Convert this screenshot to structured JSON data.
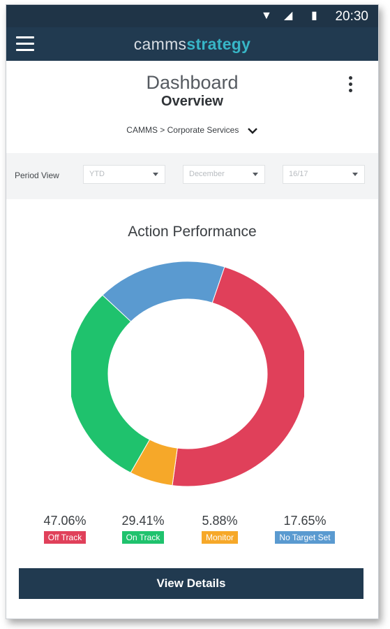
{
  "status_bar": {
    "time": "20:30",
    "icons": [
      "wifi-icon",
      "signal-icon",
      "battery-icon"
    ]
  },
  "app_bar": {
    "brand_part1": "camms",
    "brand_part2": "strategy",
    "menu_icon": "hamburger-icon"
  },
  "header": {
    "title": "Dashboard",
    "subtitle": "Overview",
    "breadcrumb": "CAMMS > Corporate Services",
    "more_icon": "kebab-menu-icon"
  },
  "period": {
    "label": "Period View",
    "selects": [
      {
        "value": "YTD"
      },
      {
        "value": "December"
      },
      {
        "value": "16/17"
      }
    ]
  },
  "chart_data": {
    "type": "pie",
    "title": "Action Performance",
    "donut": true,
    "slices": [
      {
        "label": "Off Track",
        "value": 47.06,
        "display": "47.06%",
        "color": "#e0405a"
      },
      {
        "label": "Monitor",
        "value": 5.88,
        "display": "5.88%",
        "color": "#f6a829"
      },
      {
        "label": "On Track",
        "value": 29.41,
        "display": "29.41%",
        "color": "#1fc26d"
      },
      {
        "label": "No Target Set",
        "value": 17.65,
        "display": "17.65%",
        "color": "#5a9ad0"
      }
    ],
    "legend": [
      {
        "label": "Off Track",
        "display": "47.06%",
        "color": "#e0405a"
      },
      {
        "label": "On Track",
        "display": "29.41%",
        "color": "#1fc26d"
      },
      {
        "label": "Monitor",
        "display": "5.88%",
        "color": "#f6a829"
      },
      {
        "label": "No Target Set",
        "display": "17.65%",
        "color": "#5a9ad0"
      }
    ]
  },
  "actions": {
    "view_details": "View Details"
  },
  "colors": {
    "header_bg": "#213a50",
    "brand_accent": "#37b6c7"
  }
}
